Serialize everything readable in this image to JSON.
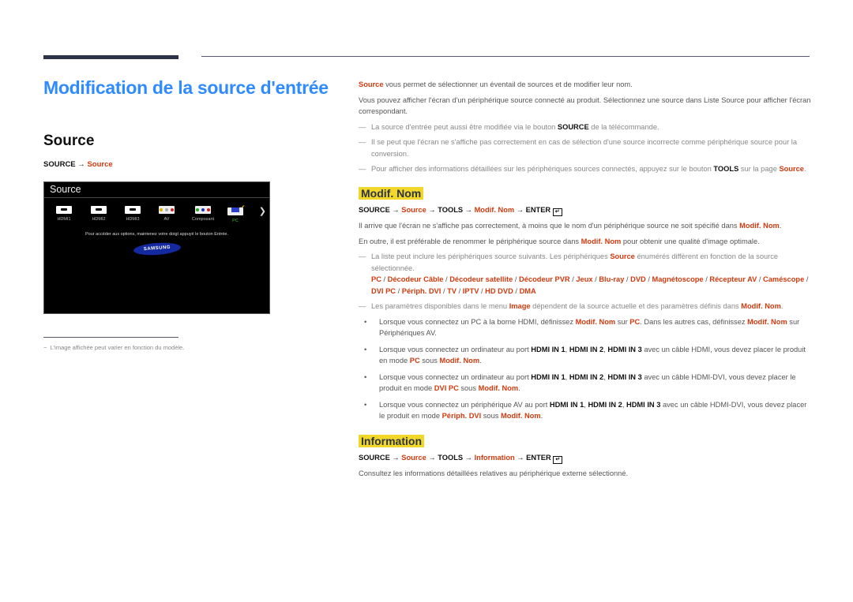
{
  "page_title": "Modification de la source d'entrée",
  "left": {
    "section_title": "Source",
    "path": {
      "prefix": "SOURCE → ",
      "link": "Source"
    },
    "tv_menu": {
      "header": "Source",
      "sources": [
        {
          "label": "HDMI1",
          "icon": "hdmi-icon"
        },
        {
          "label": "HDMI2",
          "icon": "hdmi-icon"
        },
        {
          "label": "HDMI3",
          "icon": "hdmi-icon"
        },
        {
          "label": "AV",
          "icon": "av-rca-icon"
        },
        {
          "label": "Composant",
          "icon": "component-rca-icon"
        },
        {
          "label": "PC",
          "icon": "vga-icon",
          "selected": true
        }
      ],
      "hint": "Pour accéder aux options, maintenez votre doigt appuyé le bouton Entrée.",
      "logo": "SAMSUNG",
      "check_color": "#f2b500",
      "selected_color": "#3fbf3f"
    },
    "footnote": "L'image affichée peut varier en fonction du modèle."
  },
  "right": {
    "intro_link": "Source",
    "intro_rest": " vous permet de sélectionner un éventail de sources et de modifier leur nom.",
    "para2": "Vous pouvez afficher l'écran d'un périphérique source connecté au produit. Sélectionnez une source dans Liste Source pour afficher l'écran correspondant.",
    "note1": {
      "a": "La source d'entrée peut aussi être modifiée via le bouton ",
      "b": "SOURCE",
      "c": " de la télécommande."
    },
    "note2": "Il se peut que l'écran ne s'affiche pas correctement en cas de sélection d'une source incorrecte comme périphérique source pour la conversion.",
    "note3": {
      "a": "Pour afficher des informations détaillées sur les périphériques sources connectés, appuyez sur le bouton ",
      "b": "TOOLS",
      "c": " sur la page ",
      "d": "Source",
      "e": "."
    },
    "modif": {
      "heading": "Modif. Nom",
      "path": {
        "p1": "SOURCE → ",
        "p2": "Source",
        "p3": " → TOOLS → ",
        "p4": "Modif. Nom",
        "p5": " → ENTER "
      },
      "para1": {
        "a": "Il arrive que l'écran ne s'affiche pas correctement, à moins que le nom d'un périphérique source ne soit spécifié dans ",
        "b": "Modif. Nom",
        "c": "."
      },
      "para2": {
        "a": "En outre, il est préférable de renommer le périphérique source dans ",
        "b": "Modif. Nom",
        "c": " pour obtenir une qualité d'image optimale."
      },
      "note_list": {
        "a": "La liste peut inclure les périphériques source suivants. Les périphériques ",
        "b": "Source",
        "c": " énumérés diffèrent en fonction de la source sélectionnée."
      },
      "devices": [
        "PC",
        "Décodeur Câble",
        "Décodeur satellite",
        "Décodeur PVR",
        "Jeux",
        "Blu-ray",
        "DVD",
        "Magnétoscope",
        "Récepteur AV",
        "Caméscope",
        "DVI PC",
        "Périph. DVI",
        "TV",
        "IPTV",
        "HD DVD",
        "DMA"
      ],
      "note_image": {
        "a": "Les paramètres disponibles dans le menu ",
        "b": "Image",
        "c": " dépendent de la source actuelle et des paramètres définis dans ",
        "d": "Modif. Nom",
        "e": "."
      },
      "bullet1": {
        "a": "Lorsque vous connectez un PC à la borne HDMI, définissez ",
        "b": "Modif. Nom",
        "c": " sur ",
        "d": "PC",
        "e": ". Dans les autres cas, définissez ",
        "f": "Modif. Nom",
        "g": " sur Périphériques AV."
      },
      "bullet2": {
        "a": "Lorsque vous connectez un ordinateur au port ",
        "b": "HDMI IN 1",
        "c": ", ",
        "d": "HDMI IN 2",
        "e": ", ",
        "f": "HDMI IN 3",
        "g": " avec un câble HDMI, vous devez placer le produit en mode ",
        "h": "PC",
        "i": " sous ",
        "j": "Modif. Nom",
        "k": "."
      },
      "bullet3": {
        "a": "Lorsque vous connectez un ordinateur au port ",
        "b": "HDMI IN 1",
        "c": ", ",
        "d": "HDMI IN 2",
        "e": ", ",
        "f": "HDMI IN 3",
        "g": " avec un câble HDMI-DVI, vous devez placer le produit en mode ",
        "h": "DVI PC",
        "i": " sous ",
        "j": "Modif. Nom",
        "k": "."
      },
      "bullet4": {
        "a": "Lorsque vous connectez un périphérique AV au port ",
        "b": "HDMI IN 1",
        "c": ", ",
        "d": "HDMI IN 2",
        "e": ", ",
        "f": "HDMI IN 3",
        "g": " avec un câble HDMI-DVI, vous devez placer le produit en mode ",
        "h": "Périph. DVI",
        "i": " sous ",
        "j": "Modif. Nom",
        "k": "."
      }
    },
    "info": {
      "heading": "Information",
      "path": {
        "p1": "SOURCE → ",
        "p2": "Source",
        "p3": " → TOOLS → ",
        "p4": "Information",
        "p5": " → ENTER "
      },
      "para": "Consultez les informations détaillées relatives au périphérique externe sélectionné."
    },
    "note_dash": "—",
    "enter_glyph": "↵"
  },
  "colors": {
    "title_blue": "#2f8bff",
    "link_red": "#d23a0e",
    "heading_bg": "#f0d72a",
    "rule": "#2e3447"
  }
}
